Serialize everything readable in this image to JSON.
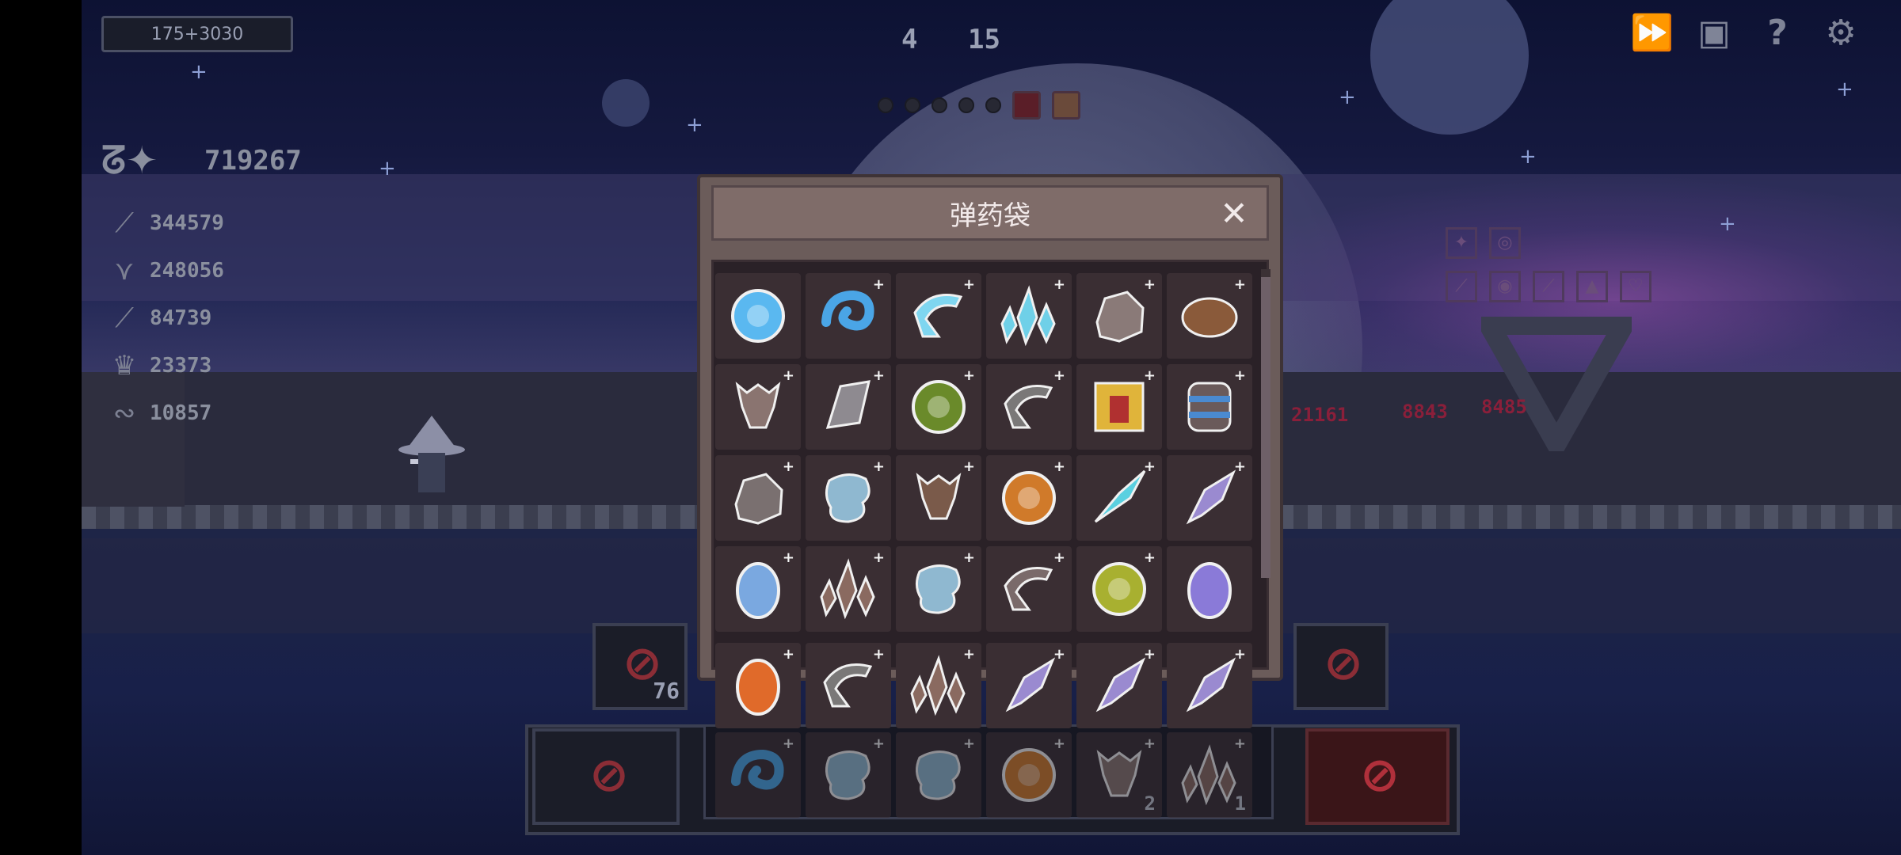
{
  "hud": {
    "experience": "175+3030",
    "wave_main": "4",
    "wave_count": "15",
    "total_score": "719267",
    "resources": [
      {
        "icon": "feather-icon",
        "value": "344579"
      },
      {
        "icon": "claw-icon",
        "value": "248056"
      },
      {
        "icon": "quill-icon",
        "value": "84739"
      },
      {
        "icon": "crown-icon",
        "value": "23373"
      },
      {
        "icon": "wave-icon",
        "value": "10857"
      }
    ],
    "top_icons": [
      "fast-forward-icon",
      "bag-icon",
      "help-icon",
      "settings-icon"
    ],
    "top_icon_glyphs": [
      "⏩",
      "▣",
      "?",
      "⚙"
    ]
  },
  "enemy": {
    "damage_numbers": [
      "21161",
      "8843",
      "8485"
    ]
  },
  "slots": {
    "left_count": "76"
  },
  "modal": {
    "title": "弹药袋",
    "close_label": "✕"
  },
  "ammo_rows": [
    [
      {
        "name": "blue-orb-icon",
        "color": "#5ab8f0",
        "shape": "orb",
        "plus": false
      },
      {
        "name": "blue-swirl-icon",
        "color": "#4aa5e6",
        "shape": "swirl",
        "plus": true
      },
      {
        "name": "cyan-claw-icon",
        "color": "#7fd6f0",
        "shape": "claw",
        "plus": true
      },
      {
        "name": "cyan-crystals-icon",
        "color": "#6fd0e8",
        "shape": "crystal",
        "plus": true
      },
      {
        "name": "stone-rock-icon",
        "color": "#8a7a78",
        "shape": "rock",
        "plus": true
      },
      {
        "name": "brown-seed-icon",
        "color": "#8a5a3a",
        "shape": "seed",
        "plus": true
      }
    ],
    [
      {
        "name": "skull-horn-icon",
        "color": "#8a7470",
        "shape": "skull",
        "plus": true
      },
      {
        "name": "grey-shard-icon",
        "color": "#8e8a90",
        "shape": "shard",
        "plus": true
      },
      {
        "name": "green-orb-icon",
        "color": "#6a8a2a",
        "shape": "orb",
        "plus": true
      },
      {
        "name": "grey-pick-icon",
        "color": "#7a7878",
        "shape": "claw",
        "plus": true
      },
      {
        "name": "gold-box-icon",
        "color": "#e0b43a",
        "shape": "box",
        "plus": true
      },
      {
        "name": "barrel-icon",
        "color": "#6a5a5a",
        "shape": "barrel",
        "plus": true
      }
    ],
    [
      {
        "name": "dark-rock-icon",
        "color": "#7a7070",
        "shape": "rock",
        "plus": true
      },
      {
        "name": "ice-chunk-icon",
        "color": "#8fb8d0",
        "shape": "chunk",
        "plus": true
      },
      {
        "name": "brown-claw-icon",
        "color": "#7a5a4a",
        "shape": "skull",
        "plus": true
      },
      {
        "name": "amber-orb-icon",
        "color": "#d07a2a",
        "shape": "orb",
        "plus": true
      },
      {
        "name": "cyan-feather-icon",
        "color": "#5ad0e0",
        "shape": "feather",
        "plus": true
      },
      {
        "name": "purple-fang-icon",
        "color": "#9a8ad0",
        "shape": "fang",
        "plus": true
      }
    ],
    [
      {
        "name": "blue-egg-icon",
        "color": "#7aa8e0",
        "shape": "egg",
        "plus": true
      },
      {
        "name": "brown-crystal-icon",
        "color": "#8a6a60",
        "shape": "crystal",
        "plus": true
      },
      {
        "name": "blue-chunk-icon",
        "color": "#8fb8d0",
        "shape": "chunk",
        "plus": true
      },
      {
        "name": "stone-pick-icon",
        "color": "#7a6a6a",
        "shape": "claw",
        "plus": true
      },
      {
        "name": "olive-orb-icon",
        "color": "#a8b030",
        "shape": "orb",
        "plus": true
      },
      {
        "name": "purple-egg-icon",
        "color": "#8a7ad8",
        "shape": "egg",
        "plus": false
      }
    ]
  ],
  "equipped": [
    {
      "name": "lava-egg-icon",
      "color": "#e06a2a",
      "shape": "egg",
      "plus": true
    },
    {
      "name": "grey-pick-icon",
      "color": "#7a7878",
      "shape": "claw",
      "plus": true
    },
    {
      "name": "brown-crystal-icon",
      "color": "#8a6a60",
      "shape": "crystal",
      "plus": true
    },
    {
      "name": "purple-fang-icon",
      "color": "#9a8ad0",
      "shape": "fang",
      "plus": true
    },
    {
      "name": "purple-fang-icon",
      "color": "#9a8ad0",
      "shape": "fang",
      "plus": true
    },
    {
      "name": "purple-fang-icon",
      "color": "#9a8ad0",
      "shape": "fang",
      "plus": true
    }
  ],
  "loadout": [
    {
      "name": "blue-swirl-icon",
      "color": "#4aa5e6",
      "shape": "swirl",
      "plus": true,
      "qty": ""
    },
    {
      "name": "ice-chunk-icon",
      "color": "#8fb8d0",
      "shape": "chunk",
      "plus": true,
      "qty": ""
    },
    {
      "name": "ice-chunk-icon",
      "color": "#8fb8d0",
      "shape": "chunk",
      "plus": true,
      "qty": ""
    },
    {
      "name": "amber-orb-icon",
      "color": "#d07a2a",
      "shape": "orb",
      "plus": true,
      "qty": ""
    },
    {
      "name": "skull-horn-icon",
      "color": "#8a7470",
      "shape": "skull",
      "plus": true,
      "qty": "2"
    },
    {
      "name": "brown-crystal-icon",
      "color": "#8a6a60",
      "shape": "crystal",
      "plus": true,
      "qty": "1"
    }
  ]
}
